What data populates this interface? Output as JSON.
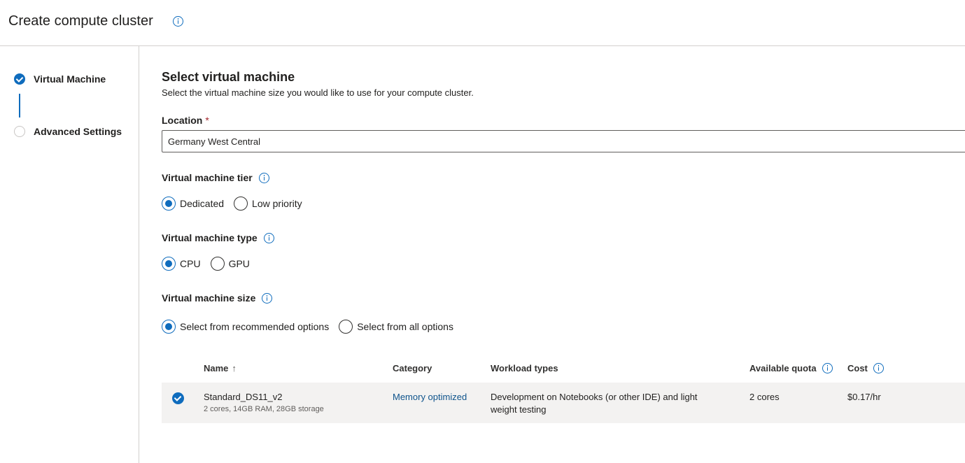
{
  "header": {
    "title": "Create compute cluster"
  },
  "steps": [
    {
      "label": "Virtual Machine",
      "status": "done"
    },
    {
      "label": "Advanced Settings",
      "status": "todo"
    }
  ],
  "section": {
    "title": "Select virtual machine",
    "description": "Select the virtual machine size you would like to use for your compute cluster."
  },
  "location": {
    "label": "Location",
    "required_mark": "*",
    "value": "Germany West Central"
  },
  "tier": {
    "label": "Virtual machine tier",
    "options": [
      "Dedicated",
      "Low priority"
    ],
    "selected": "Dedicated"
  },
  "type": {
    "label": "Virtual machine type",
    "options": [
      "CPU",
      "GPU"
    ],
    "selected": "CPU"
  },
  "size": {
    "label": "Virtual machine size",
    "options": [
      "Select from recommended options",
      "Select from all options"
    ],
    "selected": "Select from recommended options"
  },
  "table": {
    "columns": {
      "name": "Name",
      "name_sort": "↑",
      "category": "Category",
      "workload": "Workload types",
      "quota": "Available quota",
      "cost": "Cost"
    },
    "rows": [
      {
        "name": "Standard_DS11_v2",
        "specs": "2 cores, 14GB RAM, 28GB storage",
        "category": "Memory optimized",
        "workload": "Development on Notebooks (or other IDE) and light weight testing",
        "quota": "2 cores",
        "cost": "$0.17/hr",
        "selected": true
      }
    ]
  },
  "colors": {
    "accent": "#0f6cbd",
    "link": "#0f548c",
    "required": "#a4262c",
    "row_bg": "#f3f2f1"
  }
}
